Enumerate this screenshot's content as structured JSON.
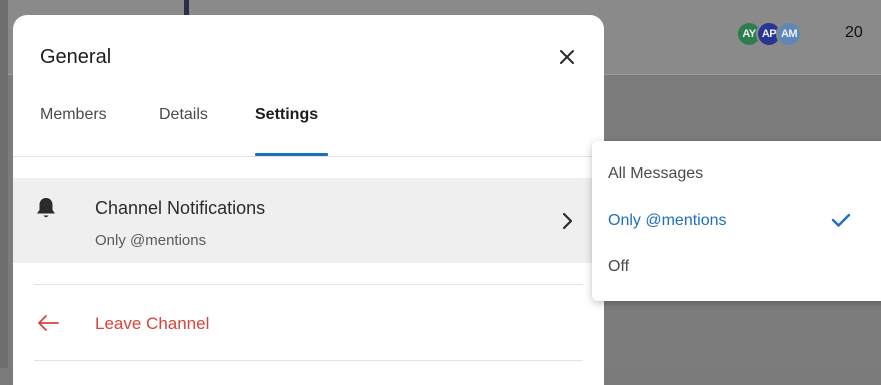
{
  "background": {
    "avatars": [
      {
        "initials": "AY",
        "color": "#2e7d4f"
      },
      {
        "initials": "AP",
        "color": "#283593"
      },
      {
        "initials": "AM",
        "color": "#5d88b8"
      }
    ],
    "member_count": "20"
  },
  "modal": {
    "title": "General",
    "close_icon": "close-icon",
    "tabs": [
      {
        "label": "Members",
        "active": false
      },
      {
        "label": "Details",
        "active": false
      },
      {
        "label": "Settings",
        "active": true
      }
    ],
    "notifications": {
      "icon": "bell-icon",
      "title": "Channel Notifications",
      "value": "Only @mentions",
      "chevron_icon": "chevron-right-icon"
    },
    "leave": {
      "icon": "arrow-left-icon",
      "label": "Leave Channel",
      "color": "#d8443b"
    }
  },
  "notification_menu": {
    "options": [
      {
        "label": "All Messages",
        "selected": false
      },
      {
        "label": "Only @mentions",
        "selected": true
      },
      {
        "label": "Off",
        "selected": false
      }
    ],
    "check_icon": "checkmark-icon",
    "accent_color": "#1f6fbf"
  }
}
